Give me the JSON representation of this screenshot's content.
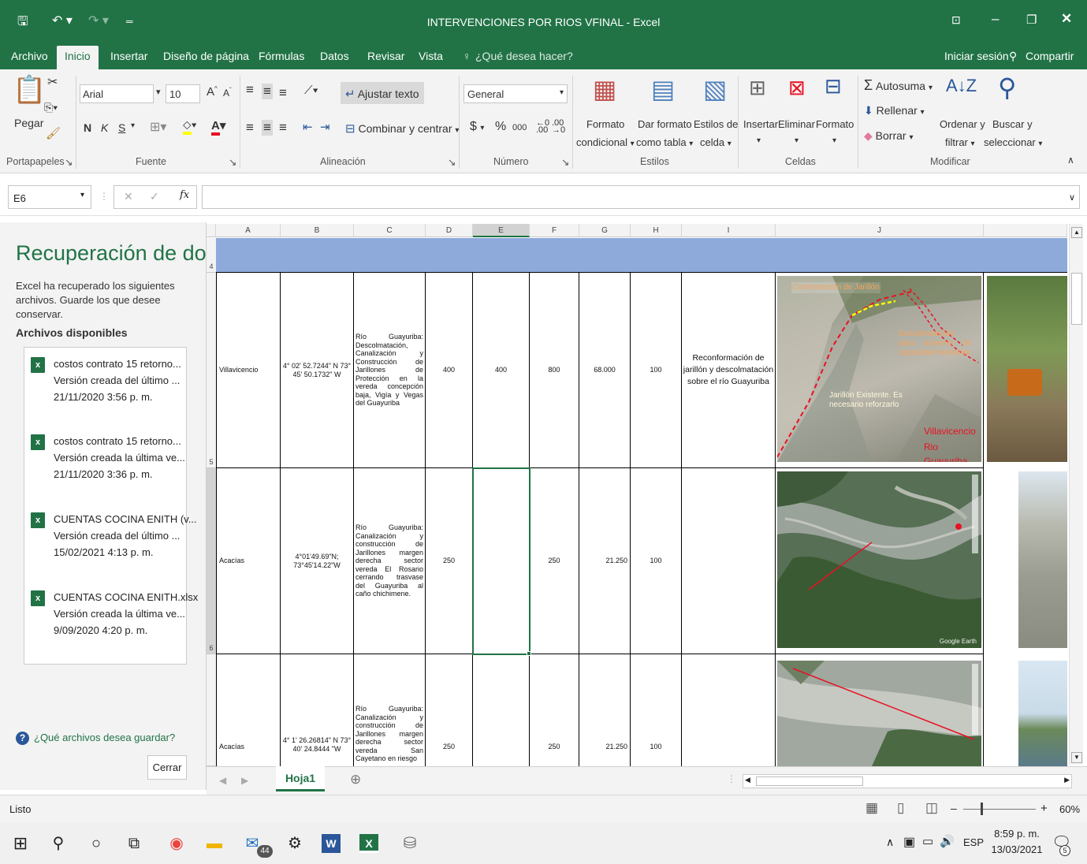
{
  "window": {
    "title": "INTERVENCIONES POR RIOS VFINAL - Excel",
    "brand_color": "#217346"
  },
  "quick_access": {
    "save_icon": "save-icon",
    "undo_icon": "undo-icon",
    "redo_icon": "redo-icon",
    "customize_icon": "customize-icon"
  },
  "window_controls": {
    "restore_ribbon": "ribbon-display-icon",
    "minimize": "minimize-icon",
    "maximize": "maximize-icon",
    "close": "close-icon"
  },
  "tabs": [
    "Archivo",
    "Inicio",
    "Insertar",
    "Diseño de página",
    "Fórmulas",
    "Datos",
    "Revisar",
    "Vista"
  ],
  "tell_me": "¿Qué desea hacer?",
  "signin": "Iniciar sesión",
  "share": "Compartir",
  "ribbon": {
    "paste": "Pegar",
    "clipboard_group": "Portapapeles",
    "font_name": "Arial",
    "font_size": "10",
    "bold": "N",
    "italic": "K",
    "underline": "S",
    "font_group": "Fuente",
    "wrap_text": "Ajustar texto",
    "merge_center": "Combinar y centrar",
    "alignment_group": "Alineación",
    "number_format": "General",
    "percent": "%",
    "thousands": "000",
    "number_group": "Número",
    "cond_format_1": "Formato",
    "cond_format_2": "condicional",
    "format_table_1": "Dar formato",
    "format_table_2": "como tabla",
    "cell_styles_1": "Estilos de",
    "cell_styles_2": "celda",
    "styles_group": "Estilos",
    "insert": "Insertar",
    "delete": "Eliminar",
    "format": "Formato",
    "cells_group": "Celdas",
    "autosum": "Autosuma",
    "fill": "Rellenar",
    "clear": "Borrar",
    "sort_1": "Ordenar y",
    "sort_2": "filtrar",
    "find_1": "Buscar y",
    "find_2": "seleccionar",
    "editing_group": "Modificar"
  },
  "formula_bar": {
    "name_box": "E6",
    "cancel": "✕",
    "enter": "✓",
    "fx": "fx",
    "value": ""
  },
  "recovery": {
    "title": "Recuperación de docu...",
    "description": "Excel ha recuperado los siguientes archivos. Guarde los que desee conservar.",
    "available": "Archivos disponibles",
    "files": [
      {
        "name": "costos contrato 15 retorno...",
        "version": "Versión creada del último ...",
        "date": "21/11/2020 3:56 p. m."
      },
      {
        "name": "costos contrato 15 retorno...",
        "version": "Versión creada la última ve...",
        "date": "21/11/2020 3:36 p. m."
      },
      {
        "name": "CUENTAS COCINA ENITH (v...",
        "version": "Versión creada del último ...",
        "date": "15/02/2021 4:13 p. m."
      },
      {
        "name": "CUENTAS COCINA ENITH.xlsx",
        "version": "Versión creada la última ve...",
        "date": "9/09/2020 4:20 p. m."
      }
    ],
    "question": "¿Qué archivos desea guardar?",
    "close": "Cerrar"
  },
  "columns": [
    "A",
    "B",
    "C",
    "D",
    "E",
    "F",
    "G",
    "H",
    "I",
    "J"
  ],
  "row_numbers": [
    "4",
    "5",
    "6"
  ],
  "rows": [
    {
      "a": "Villavicencio",
      "b": "4° 02' 52.7244\" N 73° 45' 50.1732\" W",
      "c": "Río Guayuriba: Descolmatación, Canalización y Construcción de Jarillones de Protección en la vereda concepción baja, Vigía y Vegas del Guayuriba",
      "d": "400",
      "e": "400",
      "f": "800",
      "g": "68.000",
      "h": "100",
      "i": "Reconformación de jarillón y descolmatación sobre el río Guayuriba"
    },
    {
      "a": "Acacías",
      "b": "4°01'49.69\"N; 73°45'14.22\"W",
      "c": "Río Guayuriba: Canalización y construcción de Jarillones margen derecha sector vereda El Rosario cerrando trasvase del Guayuriba al caño chichimene.",
      "d": "250",
      "e": "",
      "f": "250",
      "g": "21.250",
      "h": "100",
      "i": ""
    },
    {
      "a": "Acacías",
      "b": "4° 1' 26.26814\" N 73° 40' 24.8444 \"W",
      "c": "Río Guayuriba: Canalización y construcción de Jarillones margen derecha sector vereda San Cayetano en riesgo",
      "d": "250",
      "e": "",
      "f": "250",
      "g": "21.250",
      "h": "100",
      "i": ""
    }
  ],
  "photo1_labels": {
    "conformacion": "Conformación de Jarillón",
    "descolmatacion": "Descolmatación para aumento de capacidad hidráulica",
    "jarillon": "Jarillón Existente. Es necesario reforzarlo",
    "place1": "Villavicencio",
    "place2": "Rio Guayuriba"
  },
  "map_watermark": "Google Earth",
  "sheet": {
    "tab": "Hoja1",
    "add": "⊕"
  },
  "status": {
    "ready": "Listo",
    "zoom": "60%"
  },
  "taskbar": {
    "time": "8:59 p. m.",
    "date": "13/03/2021",
    "lang": "ESP",
    "mail_badge": "44",
    "notif_badge": "5"
  }
}
